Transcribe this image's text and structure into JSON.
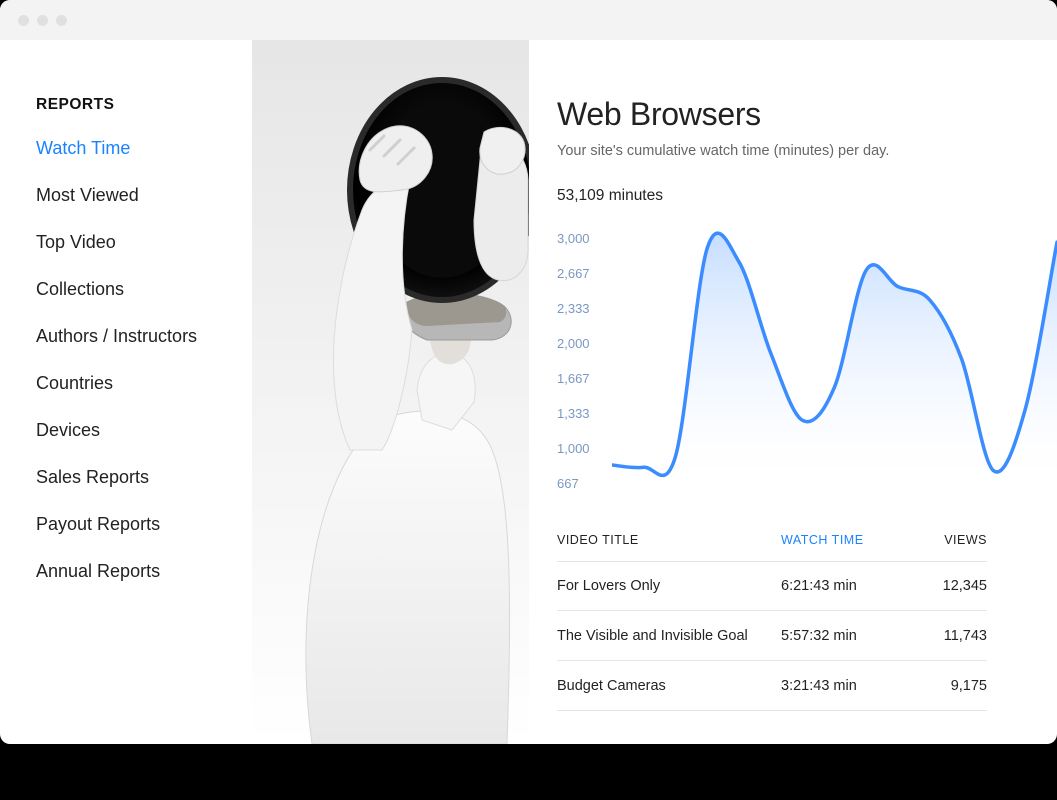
{
  "sidebar": {
    "title": "REPORTS",
    "items": [
      {
        "label": "Watch Time",
        "active": true
      },
      {
        "label": "Most Viewed",
        "active": false
      },
      {
        "label": "Top Video",
        "active": false
      },
      {
        "label": "Collections",
        "active": false
      },
      {
        "label": "Authors / Instructors",
        "active": false
      },
      {
        "label": "Countries",
        "active": false
      },
      {
        "label": "Devices",
        "active": false
      },
      {
        "label": "Sales Reports",
        "active": false
      },
      {
        "label": "Payout Reports",
        "active": false
      },
      {
        "label": "Annual Reports",
        "active": false
      }
    ]
  },
  "main": {
    "title": "Web Browsers",
    "subtitle": "Your site's cumulative watch time (minutes) per day.",
    "total": "53,109 minutes"
  },
  "chart_data": {
    "type": "line",
    "title": "",
    "xlabel": "",
    "ylabel": "",
    "y_ticks": [
      "3,000",
      "2,667",
      "2,333",
      "2,000",
      "1,667",
      "1,333",
      "1,000",
      "667"
    ],
    "ylim": [
      667,
      3000
    ],
    "x": [
      0,
      1,
      2,
      3,
      4,
      5,
      6,
      7,
      8,
      9,
      10,
      11,
      12,
      13,
      14
    ],
    "values": [
      900,
      880,
      980,
      2850,
      2720,
      1900,
      1300,
      1600,
      2650,
      2500,
      2380,
      1850,
      850,
      1400,
      2900
    ],
    "color": "#3b8cff"
  },
  "table": {
    "columns": [
      {
        "key": "title",
        "label": "VIDEO TITLE",
        "active": false
      },
      {
        "key": "watch",
        "label": "WATCH TIME",
        "active": true
      },
      {
        "key": "views",
        "label": "VIEWS",
        "active": false
      }
    ],
    "rows": [
      {
        "title": "For Lovers Only",
        "watch": "6:21:43 min",
        "views": "12,345"
      },
      {
        "title": "The Visible and Invisible Goal",
        "watch": "5:57:32 min",
        "views": "11,743"
      },
      {
        "title": "Budget Cameras",
        "watch": "3:21:43 min",
        "views": "9,175"
      }
    ]
  }
}
